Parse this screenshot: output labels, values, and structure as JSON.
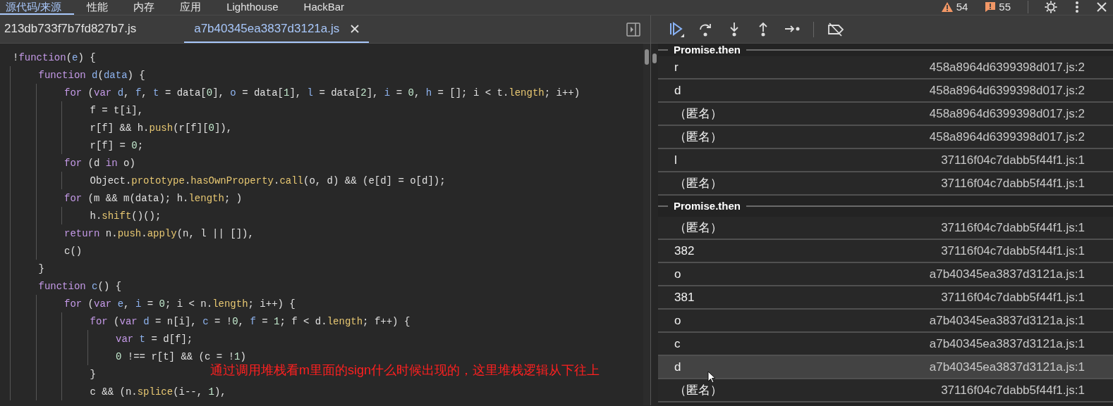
{
  "devtools_tabs": [
    {
      "label": "源代码/来源",
      "selected": true
    },
    {
      "label": "性能",
      "selected": false
    },
    {
      "label": "内存",
      "selected": false
    },
    {
      "label": "应用",
      "selected": false
    },
    {
      "label": "Lighthouse",
      "selected": false
    },
    {
      "label": "HackBar",
      "selected": false
    }
  ],
  "counters": [
    {
      "kind": "warning",
      "count": "54"
    },
    {
      "kind": "issue",
      "count": "55"
    }
  ],
  "file_tabs": [
    {
      "label": "213db733f7b7fd827b7.js",
      "selected": false,
      "closable": false
    },
    {
      "label": "a7b40345ea3837d3121a.js",
      "selected": true,
      "closable": true
    }
  ],
  "code": [
    {
      "tokens": [
        {
          "text": "!",
          "kind": "plain"
        },
        {
          "text": "function",
          "kind": "keyword"
        },
        {
          "text": "(",
          "kind": "plain"
        },
        {
          "text": "e",
          "kind": "variable"
        },
        {
          "text": ") {",
          "kind": "plain"
        }
      ],
      "children": [
        {
          "tokens": [
            {
              "text": "function",
              "kind": "keyword"
            },
            {
              "text": " d",
              "kind": "variable"
            },
            {
              "text": "(",
              "kind": "plain"
            },
            {
              "text": "data",
              "kind": "variable"
            },
            {
              "text": ") {",
              "kind": "plain"
            }
          ],
          "children": [
            {
              "tokens": [
                {
                  "text": "for",
                  "kind": "keyword"
                },
                {
                  "text": " (",
                  "kind": "plain"
                },
                {
                  "text": "var",
                  "kind": "keyword"
                },
                {
                  "text": " d",
                  "kind": "variable"
                },
                {
                  "text": ", ",
                  "kind": "plain"
                },
                {
                  "text": "f",
                  "kind": "variable"
                },
                {
                  "text": ", ",
                  "kind": "plain"
                },
                {
                  "text": "t",
                  "kind": "variable"
                },
                {
                  "text": " = data[",
                  "kind": "plain"
                },
                {
                  "text": "0",
                  "kind": "number"
                },
                {
                  "text": "], ",
                  "kind": "plain"
                },
                {
                  "text": "o",
                  "kind": "variable"
                },
                {
                  "text": " = data[",
                  "kind": "plain"
                },
                {
                  "text": "1",
                  "kind": "number"
                },
                {
                  "text": "], ",
                  "kind": "plain"
                },
                {
                  "text": "l",
                  "kind": "variable"
                },
                {
                  "text": " = data[",
                  "kind": "plain"
                },
                {
                  "text": "2",
                  "kind": "number"
                },
                {
                  "text": "], ",
                  "kind": "plain"
                },
                {
                  "text": "i",
                  "kind": "variable"
                },
                {
                  "text": " = ",
                  "kind": "plain"
                },
                {
                  "text": "0",
                  "kind": "number"
                },
                {
                  "text": ", ",
                  "kind": "plain"
                },
                {
                  "text": "h",
                  "kind": "variable"
                },
                {
                  "text": " = []; i < t.",
                  "kind": "plain"
                },
                {
                  "text": "length",
                  "kind": "method"
                },
                {
                  "text": "; i++)",
                  "kind": "plain"
                }
              ],
              "children": [
                {
                  "tokens": [
                    {
                      "text": "f = t[i],",
                      "kind": "plain"
                    }
                  ]
                },
                {
                  "tokens": [
                    {
                      "text": "r[f] && h.",
                      "kind": "plain"
                    },
                    {
                      "text": "push",
                      "kind": "method"
                    },
                    {
                      "text": "(r[f][",
                      "kind": "plain"
                    },
                    {
                      "text": "0",
                      "kind": "number"
                    },
                    {
                      "text": "]),",
                      "kind": "plain"
                    }
                  ]
                },
                {
                  "tokens": [
                    {
                      "text": "r[f] = ",
                      "kind": "plain"
                    },
                    {
                      "text": "0",
                      "kind": "number"
                    },
                    {
                      "text": ";",
                      "kind": "plain"
                    }
                  ]
                }
              ]
            },
            {
              "tokens": [
                {
                  "text": "for",
                  "kind": "keyword"
                },
                {
                  "text": " (d ",
                  "kind": "plain"
                },
                {
                  "text": "in",
                  "kind": "keyword"
                },
                {
                  "text": " o)",
                  "kind": "plain"
                }
              ],
              "children": [
                {
                  "tokens": [
                    {
                      "text": "Object.",
                      "kind": "plain"
                    },
                    {
                      "text": "prototype",
                      "kind": "method"
                    },
                    {
                      "text": ".",
                      "kind": "plain"
                    },
                    {
                      "text": "hasOwnProperty",
                      "kind": "method"
                    },
                    {
                      "text": ".",
                      "kind": "plain"
                    },
                    {
                      "text": "call",
                      "kind": "method"
                    },
                    {
                      "text": "(o, d) && (e[d] = o[d]);",
                      "kind": "plain"
                    }
                  ]
                }
              ]
            },
            {
              "tokens": [
                {
                  "text": "for",
                  "kind": "keyword"
                },
                {
                  "text": " (m && m(data); h.",
                  "kind": "plain"
                },
                {
                  "text": "length",
                  "kind": "method"
                },
                {
                  "text": "; )",
                  "kind": "plain"
                }
              ],
              "children": [
                {
                  "tokens": [
                    {
                      "text": "h.",
                      "kind": "plain"
                    },
                    {
                      "text": "shift",
                      "kind": "method"
                    },
                    {
                      "text": "()();",
                      "kind": "plain"
                    }
                  ]
                }
              ]
            },
            {
              "tokens": [
                {
                  "text": "return",
                  "kind": "keyword"
                },
                {
                  "text": " n.",
                  "kind": "plain"
                },
                {
                  "text": "push",
                  "kind": "method"
                },
                {
                  "text": ".",
                  "kind": "plain"
                },
                {
                  "text": "apply",
                  "kind": "method"
                },
                {
                  "text": "(n, l || []),",
                  "kind": "plain"
                }
              ]
            },
            {
              "tokens": [
                {
                  "text": "c()",
                  "kind": "plain"
                }
              ]
            }
          ]
        },
        {
          "tokens": [
            {
              "text": "}",
              "kind": "plain"
            }
          ]
        },
        {
          "tokens": [
            {
              "text": "function",
              "kind": "keyword"
            },
            {
              "text": " c",
              "kind": "variable"
            },
            {
              "text": "() {",
              "kind": "plain"
            }
          ],
          "children": [
            {
              "tokens": [
                {
                  "text": "for",
                  "kind": "keyword"
                },
                {
                  "text": " (",
                  "kind": "plain"
                },
                {
                  "text": "var",
                  "kind": "keyword"
                },
                {
                  "text": " e",
                  "kind": "variable"
                },
                {
                  "text": ", ",
                  "kind": "plain"
                },
                {
                  "text": "i",
                  "kind": "variable"
                },
                {
                  "text": " = ",
                  "kind": "plain"
                },
                {
                  "text": "0",
                  "kind": "number"
                },
                {
                  "text": "; i < n.",
                  "kind": "plain"
                },
                {
                  "text": "length",
                  "kind": "method"
                },
                {
                  "text": "; i++) {",
                  "kind": "plain"
                }
              ],
              "children": [
                {
                  "tokens": [
                    {
                      "text": "for",
                      "kind": "keyword"
                    },
                    {
                      "text": " (",
                      "kind": "plain"
                    },
                    {
                      "text": "var",
                      "kind": "keyword"
                    },
                    {
                      "text": " d",
                      "kind": "variable"
                    },
                    {
                      "text": " = n[i], ",
                      "kind": "plain"
                    },
                    {
                      "text": "c",
                      "kind": "variable"
                    },
                    {
                      "text": " = !",
                      "kind": "plain"
                    },
                    {
                      "text": "0",
                      "kind": "number"
                    },
                    {
                      "text": ", ",
                      "kind": "plain"
                    },
                    {
                      "text": "f",
                      "kind": "variable"
                    },
                    {
                      "text": " = ",
                      "kind": "plain"
                    },
                    {
                      "text": "1",
                      "kind": "number"
                    },
                    {
                      "text": "; f < d.",
                      "kind": "plain"
                    },
                    {
                      "text": "length",
                      "kind": "method"
                    },
                    {
                      "text": "; f++) {",
                      "kind": "plain"
                    }
                  ],
                  "children": [
                    {
                      "tokens": [
                        {
                          "text": "var",
                          "kind": "keyword"
                        },
                        {
                          "text": " t",
                          "kind": "variable"
                        },
                        {
                          "text": " = d[f];",
                          "kind": "plain"
                        }
                      ]
                    },
                    {
                      "tokens": [
                        {
                          "text": "0",
                          "kind": "number"
                        },
                        {
                          "text": " !== r[t] && (c = !",
                          "kind": "plain"
                        },
                        {
                          "text": "1",
                          "kind": "number"
                        },
                        {
                          "text": ")",
                          "kind": "plain"
                        }
                      ]
                    }
                  ]
                },
                {
                  "tokens": [
                    {
                      "text": "}",
                      "kind": "plain"
                    }
                  ]
                },
                {
                  "tokens": [
                    {
                      "text": "c && (n.",
                      "kind": "plain"
                    },
                    {
                      "text": "splice",
                      "kind": "method"
                    },
                    {
                      "text": "(i--, ",
                      "kind": "plain"
                    },
                    {
                      "text": "1",
                      "kind": "number"
                    },
                    {
                      "text": "),",
                      "kind": "plain"
                    }
                  ]
                }
              ]
            }
          ]
        }
      ]
    }
  ],
  "annotation": "通过调用堆栈看m里面的sign什么时候出现的，这里堆栈逻辑从下往上",
  "call_stack": [
    {
      "header": "Promise.then",
      "frames": [
        {
          "name": "r",
          "location": "458a8964d6399398d017.js:2",
          "hovered": false
        },
        {
          "name": "d",
          "location": "458a8964d6399398d017.js:2",
          "hovered": false
        },
        {
          "name": "（匿名）",
          "location": "458a8964d6399398d017.js:2",
          "hovered": false
        },
        {
          "name": "（匿名）",
          "location": "458a8964d6399398d017.js:2",
          "hovered": false
        },
        {
          "name": "l",
          "location": "37116f04c7dabb5f44f1.js:1",
          "hovered": false
        },
        {
          "name": "（匿名）",
          "location": "37116f04c7dabb5f44f1.js:1",
          "hovered": false
        }
      ]
    },
    {
      "header": "Promise.then",
      "frames": [
        {
          "name": "（匿名）",
          "location": "37116f04c7dabb5f44f1.js:1",
          "hovered": false
        },
        {
          "name": "382",
          "location": "37116f04c7dabb5f44f1.js:1",
          "hovered": false
        },
        {
          "name": "o",
          "location": "a7b40345ea3837d3121a.js:1",
          "hovered": false
        },
        {
          "name": "381",
          "location": "37116f04c7dabb5f44f1.js:1",
          "hovered": false
        },
        {
          "name": "o",
          "location": "a7b40345ea3837d3121a.js:1",
          "hovered": false
        },
        {
          "name": "c",
          "location": "a7b40345ea3837d3121a.js:1",
          "hovered": false
        },
        {
          "name": "d",
          "location": "a7b40345ea3837d3121a.js:1",
          "hovered": true
        },
        {
          "name": "（匿名）",
          "location": "37116f04c7dabb5f44f1.js:1",
          "hovered": false
        }
      ]
    }
  ]
}
